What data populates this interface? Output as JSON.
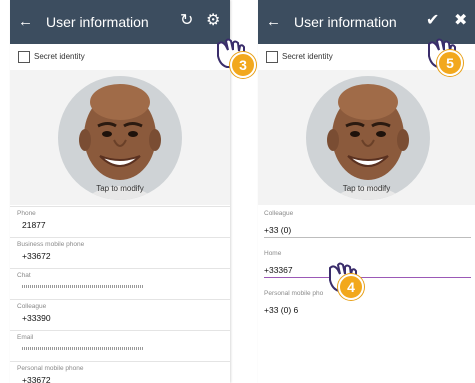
{
  "left_screen": {
    "appbar": {
      "back_icon": "arrow-left-icon",
      "title": "User information",
      "refresh_icon": "refresh-icon",
      "settings_icon": "gear-icon"
    },
    "secret_identity": {
      "label": "Secret identity",
      "checked": false
    },
    "photo": {
      "tap_text": "Tap to modify"
    },
    "fields": [
      {
        "label": "Phone",
        "value": "21877"
      },
      {
        "label": "Business mobile phone",
        "value": "+33672"
      },
      {
        "label": "Chat",
        "value": "",
        "masked": true
      },
      {
        "label": "Colleague",
        "value": "+33390"
      },
      {
        "label": "Email",
        "value": "",
        "masked": true
      },
      {
        "label": "Personal mobile phone",
        "value": "+33672"
      }
    ],
    "step_badge": "3"
  },
  "right_screen": {
    "appbar": {
      "back_icon": "arrow-left-icon",
      "title": "User information",
      "check_icon": "checkmark-icon",
      "close_icon": "close-icon"
    },
    "secret_identity": {
      "label": "Secret identity",
      "checked": false
    },
    "photo": {
      "tap_text": "Tap to modify"
    },
    "fields": [
      {
        "label": "Colleague",
        "value": "+33 (0)"
      },
      {
        "label": "Home",
        "value": "+33367"
      },
      {
        "label": "Personal mobile pho",
        "value": "+33 (0) 6"
      }
    ],
    "step_badges": [
      "4",
      "5"
    ]
  },
  "colors": {
    "appbar": "#3c4d5f",
    "badge": "#f2a81d",
    "active_underline": "#9b59b6"
  }
}
